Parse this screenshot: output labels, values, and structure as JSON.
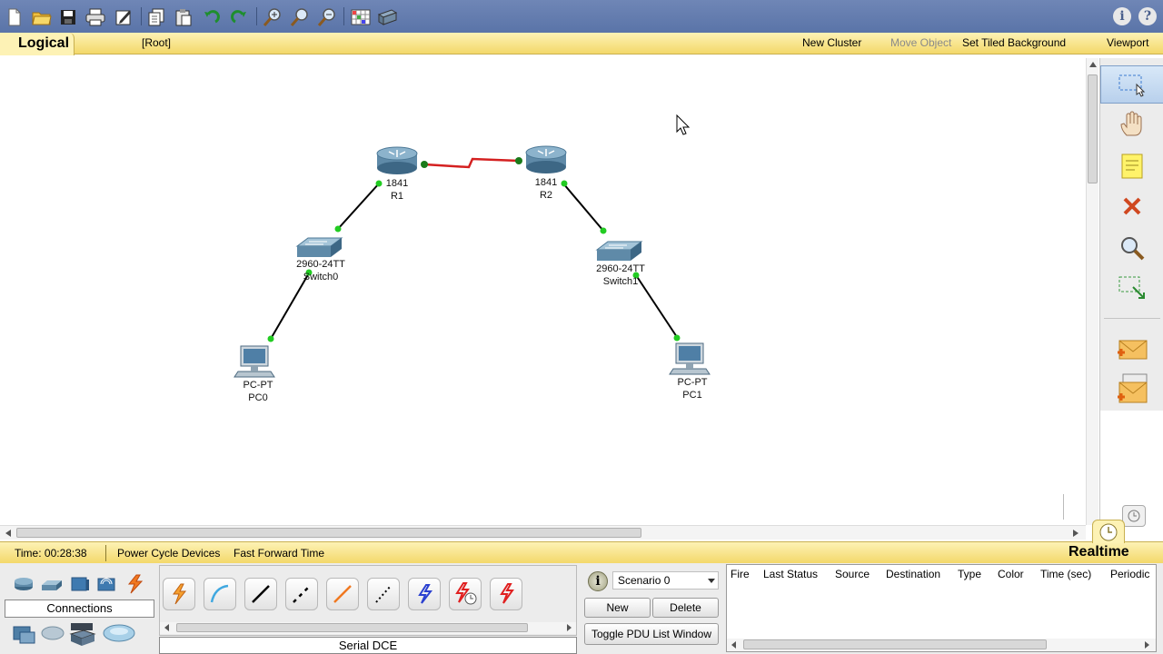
{
  "toolbar": {
    "icons": [
      "new-file-icon",
      "open-folder-icon",
      "save-icon",
      "print-icon",
      "activity-wizard-icon",
      "copy-icon",
      "paste-icon",
      "undo-icon",
      "redo-icon",
      "zoom-in-icon",
      "zoom-reset-icon",
      "zoom-out-icon",
      "palette-icon",
      "custom-device-icon",
      "info-icon",
      "help-icon"
    ]
  },
  "logical_bar": {
    "tab_label": "Logical",
    "root_label": "[Root]",
    "new_cluster": "New Cluster",
    "move_object": "Move Object",
    "set_tiled_background": "Set Tiled Background",
    "viewport": "Viewport"
  },
  "devices": {
    "r1": {
      "model": "1841",
      "name": "R1"
    },
    "r2": {
      "model": "1841",
      "name": "R2"
    },
    "switch0": {
      "model": "2960-24TT",
      "name": "Switch0"
    },
    "switch1": {
      "model": "2960-24TT",
      "name": "Switch1"
    },
    "pc0": {
      "model": "PC-PT",
      "name": "PC0"
    },
    "pc1": {
      "model": "PC-PT",
      "name": "PC1"
    }
  },
  "link_colors": {
    "serial": "#d42020",
    "copper": "#000000",
    "port_up": "#22cc22",
    "port_serial": "#1a7a1a"
  },
  "right_panel": {
    "tools": [
      "select-icon",
      "move-layout-icon",
      "place-note-icon",
      "delete-icon",
      "inspect-icon",
      "resize-shape-icon",
      "add-simple-pdu-icon",
      "add-complex-pdu-icon"
    ]
  },
  "status_bar": {
    "time": "Time: 00:28:38",
    "power_cycle": "Power Cycle Devices",
    "fast_forward": "Fast Forward Time",
    "mode": "Realtime"
  },
  "bottom": {
    "category_label": "Connections",
    "connection_type_label": "Serial DCE",
    "scenario_selected": "Scenario 0",
    "new_button": "New",
    "delete_button": "Delete",
    "toggle_pdu_button": "Toggle PDU List Window",
    "pdu_columns": [
      "Fire",
      "Last Status",
      "Source",
      "Destination",
      "Type",
      "Color",
      "Time (sec)",
      "Periodic"
    ]
  }
}
